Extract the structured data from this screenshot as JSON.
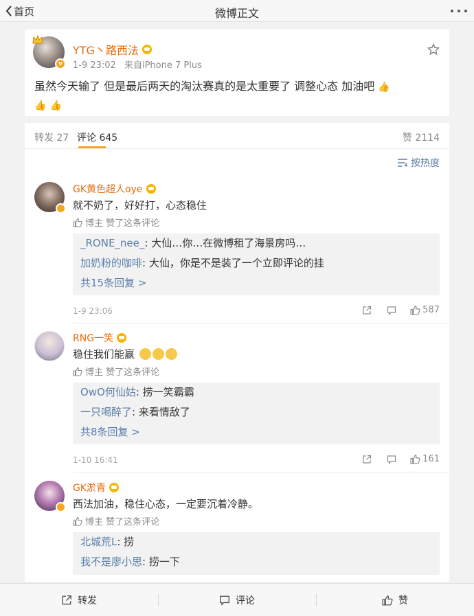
{
  "nav": {
    "back_label": "首页",
    "title": "微博正文"
  },
  "post": {
    "author": "YTG丶路西法",
    "time": "1-9 23:02",
    "source": "来自iPhone 7 Plus",
    "text": "虽然今天输了 但是最后两天的淘汰赛真的是太重要了 调整心态 加油吧"
  },
  "tabs": {
    "repost": "转发 27",
    "comments": "评论 645",
    "likes": "赞 2114",
    "sort": "按热度"
  },
  "comments": [
    {
      "name": "GK黄色超人oye",
      "text": "就不奶了，好好打，心态稳住",
      "liked_by_author": "博主 赞了这条评论",
      "replies": [
        {
          "who": "_RONE_nee_",
          "text": ": 大仙…你…在微博租了海景房吗…"
        },
        {
          "who": "加奶粉的咖啡",
          "text": ": 大仙，你是不是装了一个立即评论的挂"
        }
      ],
      "more": "共15条回复 >",
      "time": "1-9 23:06",
      "likes": "587"
    },
    {
      "name": "RNG一笑",
      "text": "稳住我们能赢",
      "liked_by_author": "博主 赞了这条评论",
      "replies": [
        {
          "who": "OwO何仙姑",
          "text": ": 捞一笑霸霸"
        },
        {
          "who": "一只喝醉了",
          "text": ": 来看情敌了"
        }
      ],
      "more": "共8条回复 >",
      "time": "1-10 16:41",
      "likes": "161"
    },
    {
      "name": "GK淤青",
      "text": "西法加油，稳住心态，一定要沉着冷静。",
      "liked_by_author": "博主 赞了这条评论",
      "replies": [
        {
          "who": "北城荒L",
          "text": ": 捞"
        },
        {
          "who": "我不是廖小思",
          "text": ": 捞一下"
        }
      ]
    }
  ],
  "bottom": {
    "repost": "转发",
    "comment": "评论",
    "like": "赞"
  },
  "colors": {
    "username": "#e86b0c",
    "link": "#5b7ea8",
    "accent": "#f5a623"
  }
}
